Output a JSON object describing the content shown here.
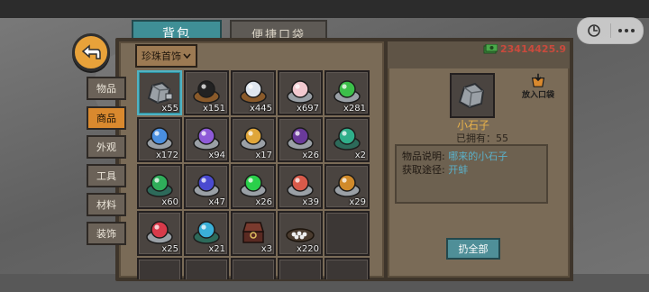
{
  "tabs": {
    "bag": "背包",
    "quick_pocket": "便捷口袋"
  },
  "filter": {
    "label": "珍珠首饰",
    "arrow": "chevron-down-icon"
  },
  "categories": [
    {
      "label": "物品",
      "active": false
    },
    {
      "label": "商品",
      "active": true
    },
    {
      "label": "外观",
      "active": false
    },
    {
      "label": "工具",
      "active": false
    },
    {
      "label": "材料",
      "active": false
    },
    {
      "label": "装饰",
      "active": false
    }
  ],
  "items": [
    {
      "icon": "stone-icon",
      "qty": "x55",
      "selected": true
    },
    {
      "icon": "black-pearl-icon",
      "qty": "x151"
    },
    {
      "icon": "white-pearl-icon",
      "qty": "x445"
    },
    {
      "icon": "pink-pearl-icon",
      "qty": "x697"
    },
    {
      "icon": "green-pearl-icon",
      "qty": "x281"
    },
    {
      "icon": "blue-pearl-icon",
      "qty": "x172"
    },
    {
      "icon": "purple-pearl-icon",
      "qty": "x94"
    },
    {
      "icon": "gold-pearl-icon",
      "qty": "x17"
    },
    {
      "icon": "violet-pearl-icon",
      "qty": "x26"
    },
    {
      "icon": "green-jade-icon",
      "qty": "x2"
    },
    {
      "icon": "green-pendant-icon",
      "qty": "x60"
    },
    {
      "icon": "indigo-pearl-icon",
      "qty": "x47"
    },
    {
      "icon": "emerald-pearl-icon",
      "qty": "x26"
    },
    {
      "icon": "striped-pearl-icon",
      "qty": "x39"
    },
    {
      "icon": "tiger-eye-pearl-icon",
      "qty": "x29"
    },
    {
      "icon": "red-pearl-icon",
      "qty": "x25"
    },
    {
      "icon": "teal-pearl-icon",
      "qty": "x21"
    },
    {
      "icon": "ring-box-icon",
      "qty": "x3"
    },
    {
      "icon": "pearl-tray-icon",
      "qty": "x220"
    },
    {
      "icon": "",
      "qty": ""
    }
  ],
  "money": {
    "value": "23414425.9",
    "icon": "cash-icon"
  },
  "detail": {
    "put_pocket": "放入口袋",
    "item_name": "小石子",
    "owned": "已拥有：55",
    "desc_label": "物品说明:",
    "desc_value": "哪来的小石子",
    "source_label": "获取途径:",
    "source_value": "开蚌",
    "sell_all": "扔全部"
  },
  "colors": {
    "accent": "#4fb3c4",
    "money": "#c94a3d",
    "item_name": "#e8b24a"
  }
}
